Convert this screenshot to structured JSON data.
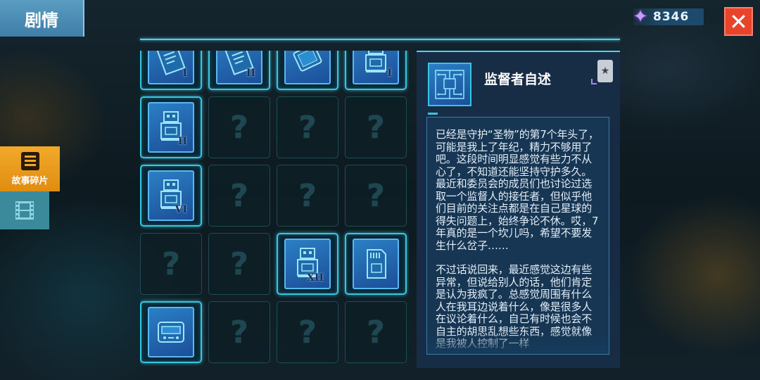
{
  "header": {
    "title": "剧情"
  },
  "sidebar": {
    "tabs": [
      {
        "label": "故事碎片",
        "icon": "story-fragments-icon",
        "active": true
      },
      {
        "label": "",
        "icon": "film-icon",
        "active": false
      }
    ]
  },
  "currency": {
    "icon": "purple-star-gem-icon",
    "amount": "8346"
  },
  "close": {
    "label": "✕"
  },
  "grid": {
    "cells": [
      {
        "state": "unlocked",
        "icon": "document-icon",
        "numeral": "I"
      },
      {
        "state": "unlocked",
        "icon": "document-icon",
        "numeral": "II"
      },
      {
        "state": "unlocked",
        "icon": "tablet-icon",
        "numeral": ""
      },
      {
        "state": "unlocked",
        "icon": "robot-icon",
        "numeral": "I"
      },
      {
        "state": "unlocked",
        "icon": "robot-icon",
        "numeral": "II"
      },
      {
        "state": "locked",
        "label": "?"
      },
      {
        "state": "locked",
        "label": "?"
      },
      {
        "state": "locked",
        "label": "?"
      },
      {
        "state": "unlocked",
        "icon": "robot-icon",
        "numeral": "VI"
      },
      {
        "state": "locked",
        "label": "?"
      },
      {
        "state": "locked",
        "label": "?"
      },
      {
        "state": "locked",
        "label": "?"
      },
      {
        "state": "locked",
        "label": "?"
      },
      {
        "state": "locked",
        "label": "?"
      },
      {
        "state": "unlocked",
        "icon": "robot-icon",
        "numeral": "XII"
      },
      {
        "state": "unlocked",
        "icon": "sd-card-icon",
        "numeral": ""
      },
      {
        "state": "unlocked",
        "icon": "device-icon",
        "numeral": ""
      },
      {
        "state": "locked",
        "label": "?"
      },
      {
        "state": "locked",
        "label": "?"
      },
      {
        "state": "locked",
        "label": "?"
      }
    ]
  },
  "detail": {
    "icon": "circuit-board-icon",
    "title": "监督者自述",
    "badge_icon": "star-badge-icon",
    "paragraphs": [
      "已经是守护“圣物”的第7个年头了，可能是我上了年纪，精力不够用了吧。这段时间明显感觉有些力不从心了，不知道还能坚持守护多久。最近和委员会的成员们也讨论过选取一个监督人的接任者，但似乎他们目前的关注点都是在自己星球的得失问题上，始终争论不休。哎，7年真的是一个坎儿吗，希望不要发生什么岔子……",
      "不过话说回来，最近感觉这边有些异常，但说给别人的话，他们肯定是认为我疯了。总感觉周围有什么人在我耳边说着什么，像是很多人在议论着什么，自己有时候也会不自主的胡思乱想些东西，感觉就像是我被人控制了一样"
    ]
  }
}
